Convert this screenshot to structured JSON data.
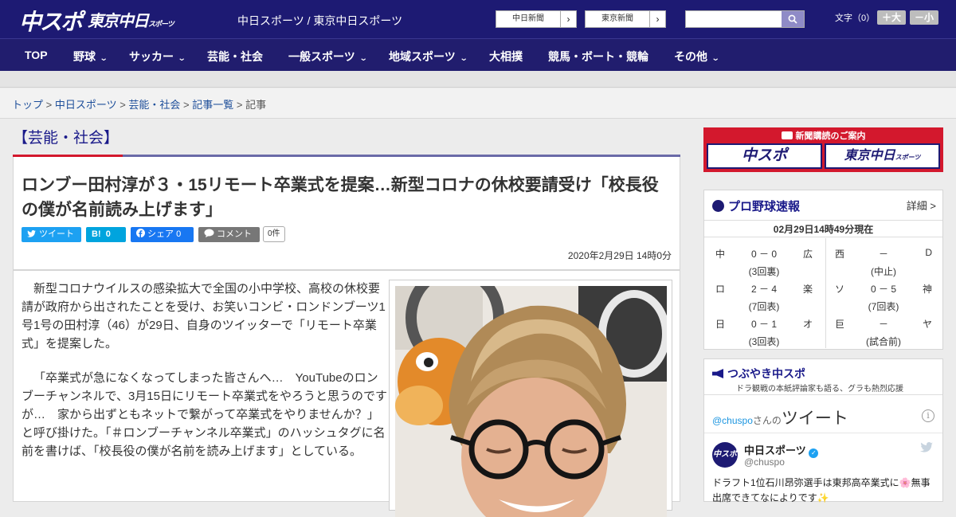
{
  "header": {
    "logo_chuspo": "中スポ",
    "logo_tokyo": "東京中日",
    "logo_tokyo_sub": "スポーツ",
    "site_name": "中日スポーツ / 東京中日スポーツ",
    "btn_chunichi": "中日新聞",
    "btn_tokyo": "東京新聞",
    "btn_arrow": "›",
    "search_placeholder": "",
    "search_icon": "search-icon",
    "font_size_label": "文字（0）",
    "font_larger": "＋大",
    "font_smaller": "－小"
  },
  "nav": {
    "items": [
      {
        "label": "TOP"
      },
      {
        "label": "野球",
        "dropdown": "⌄"
      },
      {
        "label": "サッカー",
        "dropdown": "⌄"
      },
      {
        "label": "芸能・社会"
      },
      {
        "label": "一般スポーツ",
        "dropdown": "⌄"
      },
      {
        "label": "地域スポーツ",
        "dropdown": "⌄"
      },
      {
        "label": "大相撲"
      },
      {
        "label": "競馬・ボート・競輪"
      },
      {
        "label": "その他",
        "dropdown": "⌄"
      }
    ]
  },
  "breadcrumb": {
    "items": [
      "トップ",
      "中日スポーツ",
      "芸能・社会",
      "記事一覧"
    ],
    "sep": " > ",
    "current": "記事"
  },
  "category_title": "【芸能・社会】",
  "article": {
    "headline": "ロンブー田村淳が３・15リモート卒業式を提案…新型コロナの休校要請受け「校長役の僕が名前読み上げます」",
    "share": {
      "tweet": "ツイート",
      "hatena_label": "B!",
      "hatena_count": "0",
      "facebook": "シェア",
      "facebook_count": "0",
      "comment": "コメント",
      "comment_count": "0件"
    },
    "date": "2020年2月29日 14時0分",
    "paragraphs": [
      "新型コロナウイルスの感染拡大で全国の小中学校、高校の休校要請が政府から出されたことを受け、お笑いコンビ・ロンドンブーツ1号1号の田村淳（46）が29日、自身のツイッターで「リモート卒業式」を提案した。",
      "「卒業式が急になくなってしまった皆さんへ…　YouTubeのロンブーチャンネルで、3月15日にリモート卒業式をやろうと思うのですが…　家から出ずともネットで繋がって卒業式をやりませんか？」と呼び掛けた。「＃ロンブーチャンネル卒業式」のハッシュタグに名前を書けば、「校長役の僕が名前を読み上げます」としている。"
    ]
  },
  "sidebar": {
    "subscribe": {
      "title": "新聞購読のご案内",
      "btn1": "中スポ",
      "btn2": "東京中日",
      "btn2_sub": "スポーツ"
    },
    "baseball": {
      "title": "プロ野球速報",
      "detail": "詳細 >",
      "time": "02月29日14時49分現在",
      "games": [
        {
          "home": "中",
          "away": "広",
          "score": "0 － 0",
          "status": "(3回裏)"
        },
        {
          "home": "西",
          "away": "D",
          "score": "－",
          "status": "(中止)"
        },
        {
          "home": "ロ",
          "away": "楽",
          "score": "2 － 4",
          "status": "(7回表)"
        },
        {
          "home": "ソ",
          "away": "神",
          "score": "0 － 5",
          "status": "(7回表)"
        },
        {
          "home": "日",
          "away": "オ",
          "score": "0 － 1",
          "status": "(3回表)"
        },
        {
          "home": "巨",
          "away": "ヤ",
          "score": "－",
          "status": "(試合前)"
        }
      ]
    },
    "tweets": {
      "title": "つぶやき中スポ",
      "subtitle": "ドラ観戦の本紙評論家も語る、グラも熱烈応援",
      "handle_link": "@chuspo",
      "san": "さんの",
      "tweet_word": "ツイート",
      "info": "i",
      "account_name": "中日スポーツ",
      "account_handle": "@chuspo",
      "avatar_text": "中スポ",
      "text": "ドラフト1位石川昂弥選手は東邦高卒業式に🌸無事出席できてなによりです✨"
    }
  },
  "colors": {
    "header_bg": "#1d1a73",
    "accent_red": "#d3182d",
    "twitter": "#1da1f2",
    "hatena": "#00a4de",
    "facebook": "#1877f2"
  }
}
